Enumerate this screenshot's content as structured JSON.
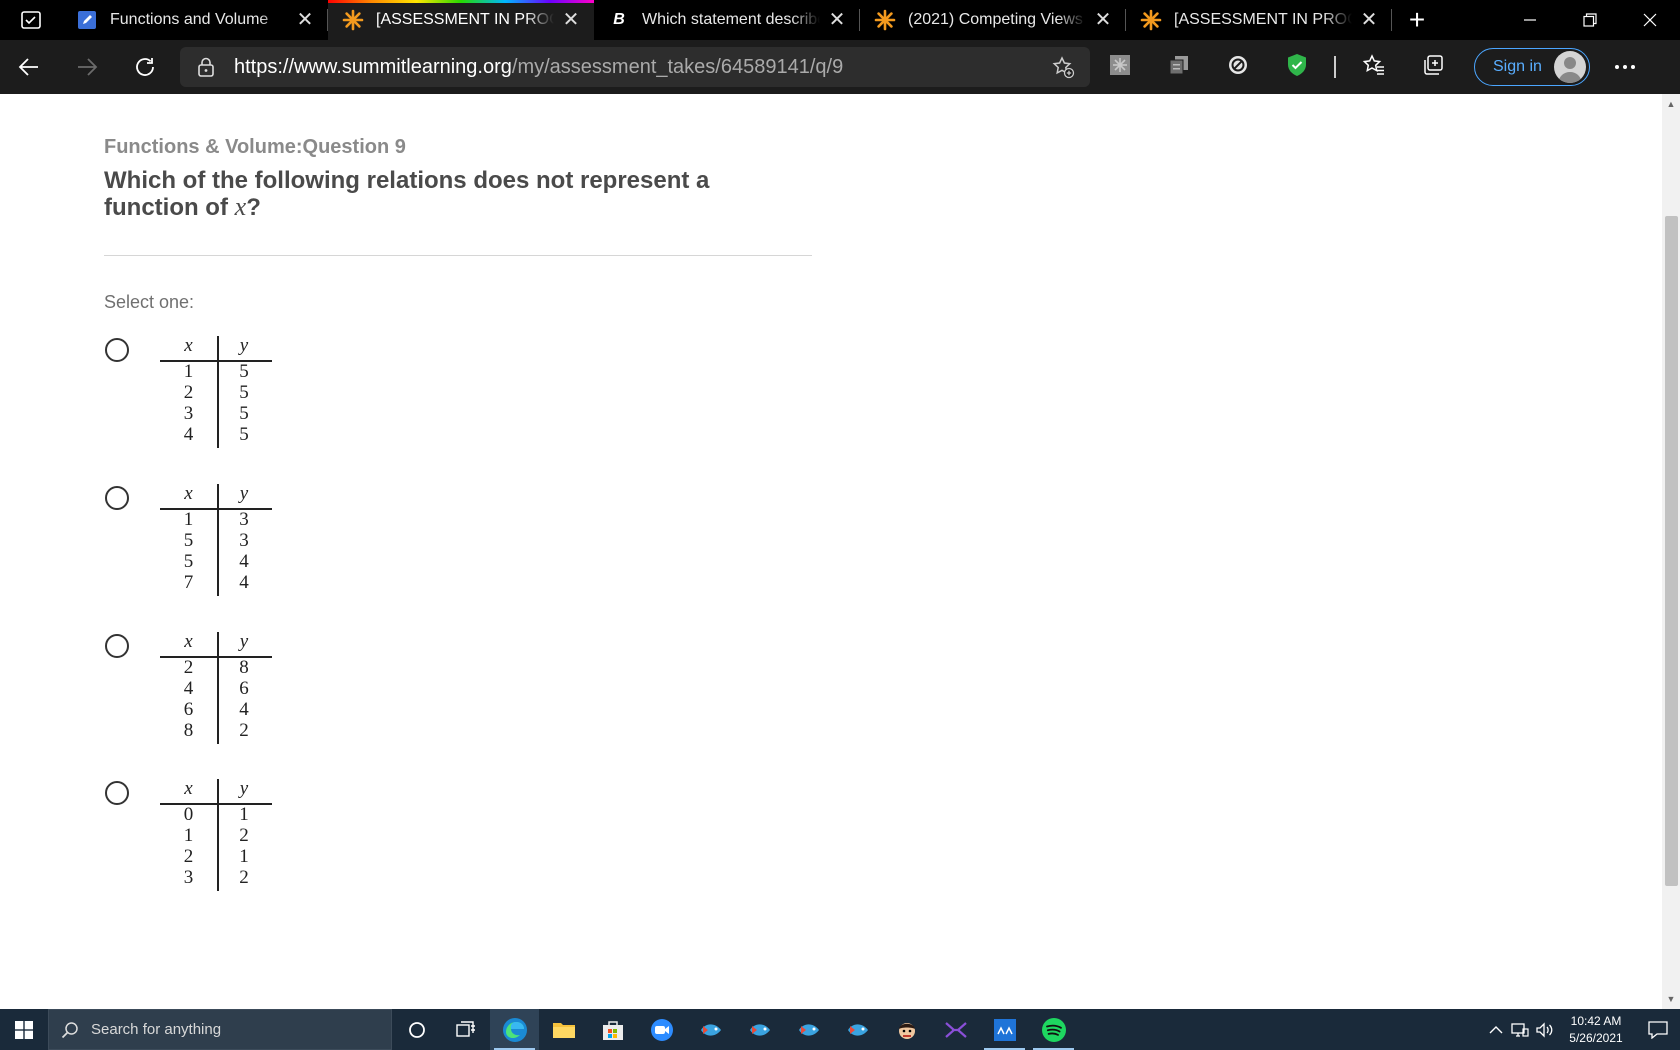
{
  "browser": {
    "tabs": [
      {
        "title": "Functions and Volume",
        "favicon": "document-pencil-icon",
        "active": false
      },
      {
        "title": "[ASSESSMENT IN PROGRESS]",
        "favicon": "summit-sun-icon",
        "active": true
      },
      {
        "title": "Which statement describes",
        "favicon": "brainly-b-icon",
        "active": false
      },
      {
        "title": "(2021) Competing Views",
        "favicon": "summit-sun-icon",
        "active": false
      },
      {
        "title": "[ASSESSMENT IN PROGRESS]",
        "favicon": "summit-sun-icon",
        "active": false
      }
    ],
    "close_glyph": "✕",
    "new_tab_glyph": "+",
    "url_host": "https://www.summitlearning.org",
    "url_path": "/my/assessment_takes/64589141/q/9",
    "sign_in_label": "Sign in",
    "accent": "#4ba6ff"
  },
  "question": {
    "header": "Functions & Volume:Question 9",
    "title_before": "Which of the following relations does not represent a function of ",
    "title_var": "x",
    "title_after": "?",
    "select_label": "Select one:",
    "col_x": "x",
    "col_y": "y",
    "options": [
      {
        "rows": [
          [
            "1",
            "5"
          ],
          [
            "2",
            "5"
          ],
          [
            "3",
            "5"
          ],
          [
            "4",
            "5"
          ]
        ]
      },
      {
        "rows": [
          [
            "1",
            "3"
          ],
          [
            "5",
            "3"
          ],
          [
            "5",
            "4"
          ],
          [
            "7",
            "4"
          ]
        ]
      },
      {
        "rows": [
          [
            "2",
            "8"
          ],
          [
            "4",
            "6"
          ],
          [
            "6",
            "4"
          ],
          [
            "8",
            "2"
          ]
        ]
      },
      {
        "rows": [
          [
            "0",
            "1"
          ],
          [
            "1",
            "2"
          ],
          [
            "2",
            "1"
          ],
          [
            "3",
            "2"
          ]
        ]
      }
    ]
  },
  "taskbar": {
    "search_placeholder": "Search for anything",
    "time": "10:42 AM",
    "date": "5/26/2021"
  }
}
